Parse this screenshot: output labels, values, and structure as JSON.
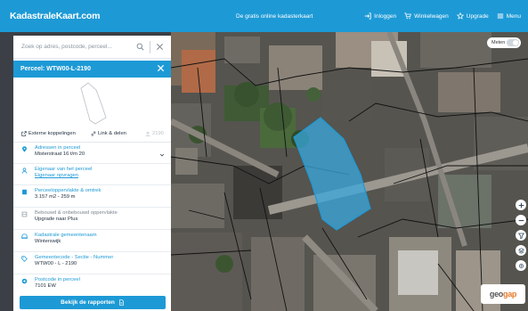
{
  "header": {
    "logo": "KadastraleKaart.com",
    "tagline": "De gratis online kadasterkaart",
    "nav": {
      "login": "Inloggen",
      "cart": "Winkelwagen",
      "upgrade": "Upgrade",
      "menu": "Menu"
    }
  },
  "search": {
    "placeholder": "Zoek op adres, postcode, perceel..."
  },
  "parcel": {
    "title": "Perceel: WTW00-L-2190",
    "actions": {
      "external": "Externe koppelingen",
      "share": "Link & delen",
      "disabled": "2190"
    },
    "rows": [
      {
        "label": "Adressen in perceel",
        "value": "Misterstraat 16 t/m 20",
        "icon": "map-pin-icon"
      },
      {
        "label": "Eigenaar van het perceel",
        "link": "Eigenaar opvragen",
        "icon": "user-icon"
      },
      {
        "label": "Perceeloppervlakte & omtrek",
        "value": "3.157 m2 - 259 m",
        "icon": "area-icon"
      },
      {
        "label": "Bebouwd & onbebouwd oppervlakte",
        "value": "Upgrade naar Plus",
        "icon": "building-icon"
      },
      {
        "label": "Kadastrale gemeentenaam",
        "value": "Winterswijk",
        "icon": "municipality-icon"
      },
      {
        "label": "Gemeentecode - Sectie - Nummer",
        "value": "WTW00 - L - 2190",
        "icon": "tag-icon"
      },
      {
        "label": "Postcode in perceel",
        "value": "7101 EW",
        "icon": "postcode-icon"
      }
    ],
    "report_button": "Bekijk de rapporten"
  },
  "map": {
    "measure_label": "Meten",
    "attribution": {
      "part1": "geo",
      "part2": "gap"
    },
    "parcel_color": "#3aa8de"
  },
  "colors": {
    "brand": "#1d9ad6"
  }
}
